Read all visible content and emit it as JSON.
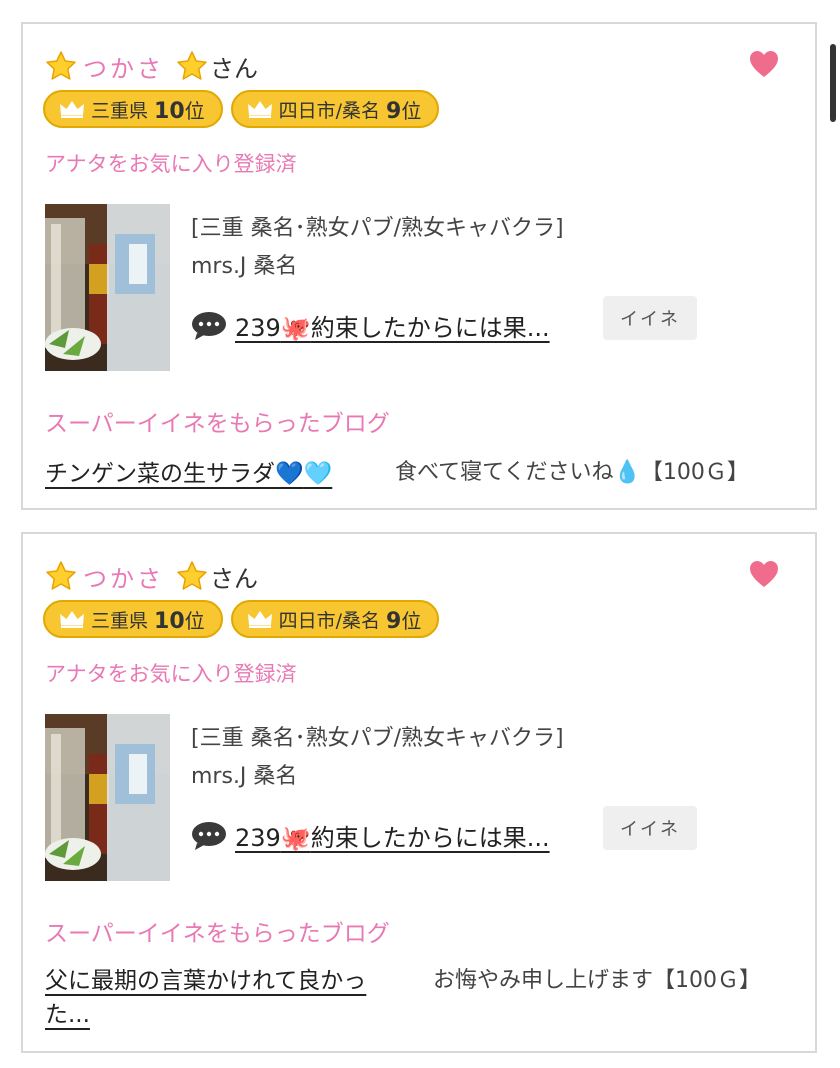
{
  "cards": [
    {
      "user_name": "つかさ",
      "suffix": "さん",
      "badges": [
        {
          "area": "三重県",
          "rank": "10",
          "unit": "位"
        },
        {
          "area": "四日市/桑名",
          "rank": "9",
          "unit": "位"
        }
      ],
      "favorite_status": "アナタをお気に入り登録済",
      "shop_category": "[三重 桑名･熟女パブ/熟女キャバクラ]",
      "shop_name": "mrs.J 桑名",
      "comment_count": "239",
      "comment_text": "約束したからには果...",
      "iine_label": "イイネ",
      "super_label": "スーパーイイネをもらったブログ",
      "blog_title": "チンゲン菜の生サラダ",
      "blog_comment": "食べて寝てくださいね",
      "blog_reward": "【100Ｇ】"
    },
    {
      "user_name": "つかさ",
      "suffix": "さん",
      "badges": [
        {
          "area": "三重県",
          "rank": "10",
          "unit": "位"
        },
        {
          "area": "四日市/桑名",
          "rank": "9",
          "unit": "位"
        }
      ],
      "favorite_status": "アナタをお気に入り登録済",
      "shop_category": "[三重 桑名･熟女パブ/熟女キャバクラ]",
      "shop_name": "mrs.J 桑名",
      "comment_count": "239",
      "comment_text": "約束したからには果...",
      "iine_label": "イイネ",
      "super_label": "スーパーイイネをもらったブログ",
      "blog_title": "父に最期の言葉かけれて良かった...",
      "blog_comment": "お悔やみ申し上げます【100Ｇ】"
    }
  ],
  "colors": {
    "accent_pink": "#e879b4",
    "badge_gold": "#f7c631",
    "heart": "#f06c8c"
  },
  "icons": [
    "star-icon",
    "heart-icon",
    "crown-icon",
    "speech-bubble-icon",
    "octopus-emoji",
    "blue-heart-emoji",
    "droplet-emoji"
  ]
}
